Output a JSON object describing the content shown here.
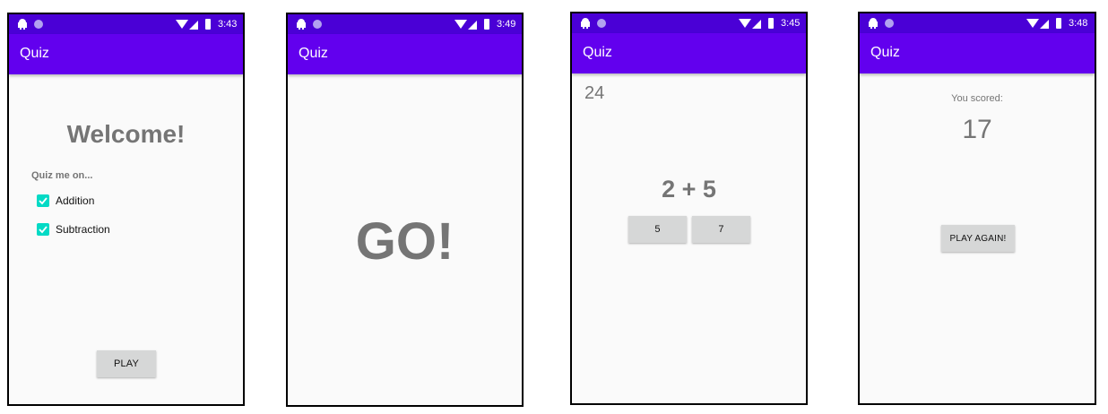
{
  "screens": [
    {
      "status_time": "3:43",
      "app_title": "Quiz",
      "welcome": "Welcome!",
      "quiz_me_on": "Quiz me on...",
      "options": [
        {
          "label": "Addition",
          "checked": true
        },
        {
          "label": "Subtraction",
          "checked": true
        }
      ],
      "play_button": "PLAY"
    },
    {
      "status_time": "3:49",
      "app_title": "Quiz",
      "go_text": "GO!"
    },
    {
      "status_time": "3:45",
      "app_title": "Quiz",
      "timer": "24",
      "question": "2 + 5",
      "answers": [
        "5",
        "7"
      ]
    },
    {
      "status_time": "3:48",
      "app_title": "Quiz",
      "you_scored": "You scored:",
      "score": "17",
      "play_again_button": "PLAY AGAIN!"
    }
  ],
  "colors": {
    "app_bar": "#6200ee",
    "status_bar": "#4a00d6",
    "checkbox": "#03dac5",
    "button": "#d6d7d7",
    "text_gray": "#757575"
  },
  "icons": {
    "status_left": [
      "android-debug-icon",
      "notification-dot-icon"
    ],
    "status_right": [
      "wifi-icon",
      "cell-signal-icon",
      "battery-icon"
    ],
    "checkbox": "check-icon"
  }
}
